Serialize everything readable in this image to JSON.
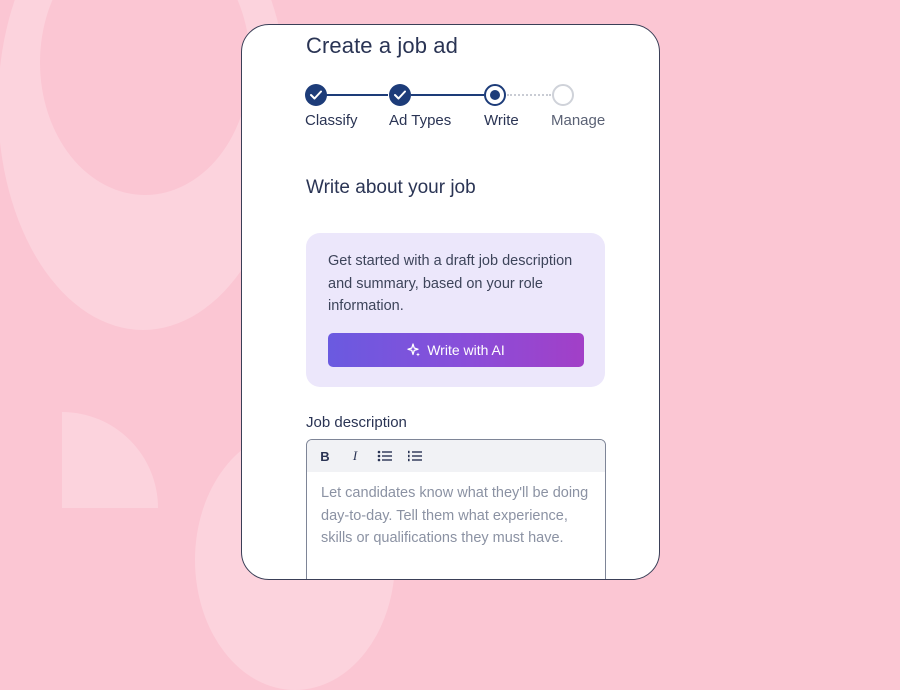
{
  "page": {
    "title": "Create a job ad"
  },
  "stepper": {
    "steps": [
      {
        "label": "Classify",
        "state": "done"
      },
      {
        "label": "Ad Types",
        "state": "done"
      },
      {
        "label": "Write",
        "state": "current"
      },
      {
        "label": "Manage",
        "state": "upcoming"
      }
    ]
  },
  "section": {
    "title": "Write about your job"
  },
  "ai_card": {
    "description": "Get started with a draft job description and summary, based on your role information.",
    "button_label": "Write with AI",
    "button_icon": "sparkle-icon"
  },
  "job_description": {
    "label": "Job description",
    "placeholder": "Let candidates know what they'll be doing day-to-day. Tell them what experience, skills or qualifications they must have.",
    "toolbar": {
      "bold": "B",
      "italic": "I",
      "bullet_list_icon": "bullet-list-icon",
      "numbered_list_icon": "numbered-list-icon"
    }
  },
  "colors": {
    "background": "#fbc6d3",
    "primary": "#1d3c79",
    "card": "#ece7fb",
    "ai_gradient_start": "#6a5ae0",
    "ai_gradient_end": "#a23fc7"
  }
}
